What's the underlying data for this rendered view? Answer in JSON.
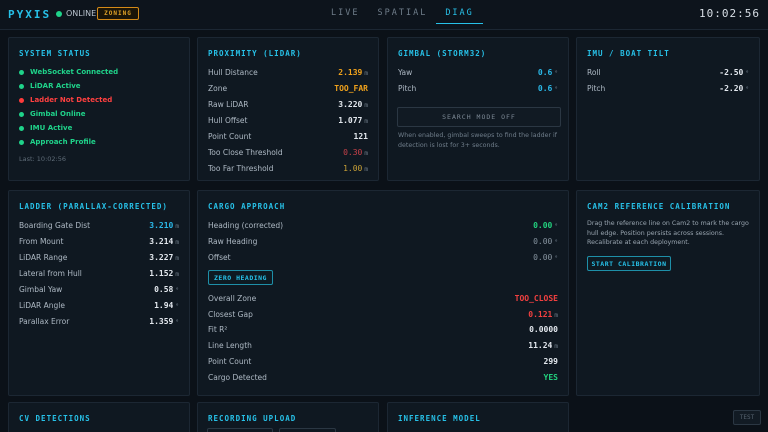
{
  "app": {
    "brand": "PYXIS",
    "online_label": "ONLINE",
    "zoning_badge": "ZONING",
    "clock": "10:02:56"
  },
  "tabs": [
    {
      "label": "LIVE"
    },
    {
      "label": "SPATIAL"
    },
    {
      "label": "DIAG"
    }
  ],
  "system_status": {
    "title": "SYSTEM STATUS",
    "items": [
      {
        "label": "WebSocket Connected",
        "state": "ok"
      },
      {
        "label": "LiDAR Active",
        "state": "ok"
      },
      {
        "label": "Ladder Not Detected",
        "state": "bad"
      },
      {
        "label": "Gimbal Online",
        "state": "ok"
      },
      {
        "label": "IMU Active",
        "state": "ok"
      },
      {
        "label": "Approach Profile",
        "state": "ok"
      }
    ],
    "last_update": "Last: 10:02:56"
  },
  "proximity": {
    "title": "PROXIMITY (LIDAR)",
    "rows": [
      {
        "label": "Hull Distance",
        "value": "2.139",
        "unit": "m"
      },
      {
        "label": "Zone",
        "value": "TOO_FAR",
        "unit": ""
      },
      {
        "label": "Raw LiDAR",
        "value": "3.220",
        "unit": "m"
      },
      {
        "label": "Hull Offset",
        "value": "1.077",
        "unit": "m"
      },
      {
        "label": "Point Count",
        "value": "121",
        "unit": ""
      },
      {
        "label": "Too Close Threshold",
        "value": "0.30",
        "unit": "m"
      },
      {
        "label": "Too Far Threshold",
        "value": "1.00",
        "unit": "m"
      }
    ]
  },
  "gimbal": {
    "title": "GIMBAL (STORM32)",
    "rows": [
      {
        "label": "Yaw",
        "value": "0.6",
        "unit": "°"
      },
      {
        "label": "Pitch",
        "value": "0.6",
        "unit": "°"
      }
    ],
    "search_button": "SEARCH MODE OFF",
    "note": "When enabled, gimbal sweeps to find the ladder if detection is lost for 3+ seconds."
  },
  "imu": {
    "title": "IMU / BOAT TILT",
    "rows": [
      {
        "label": "Roll",
        "value": "-2.50",
        "unit": "°"
      },
      {
        "label": "Pitch",
        "value": "-2.20",
        "unit": "°"
      }
    ]
  },
  "ladder": {
    "title": "LADDER (PARALLAX-CORRECTED)",
    "rows": [
      {
        "label": "Boarding Gate Dist",
        "value": "3.210",
        "unit": "m"
      },
      {
        "label": "From Mount",
        "value": "3.214",
        "unit": "m"
      },
      {
        "label": "LiDAR Range",
        "value": "3.227",
        "unit": "m"
      },
      {
        "label": "Lateral from Hull",
        "value": "1.152",
        "unit": "m"
      },
      {
        "label": "Gimbal Yaw",
        "value": "0.58",
        "unit": "°"
      },
      {
        "label": "LiDAR Angle",
        "value": "1.94",
        "unit": "°"
      },
      {
        "label": "Parallax Error",
        "value": "1.359",
        "unit": "°"
      }
    ]
  },
  "cargo": {
    "title": "CARGO APPROACH",
    "rows_top": [
      {
        "label": "Heading (corrected)",
        "value": "0.00",
        "unit": "°"
      },
      {
        "label": "Raw Heading",
        "value": "0.00",
        "unit": "°"
      },
      {
        "label": "Offset",
        "value": "0.00",
        "unit": "°"
      }
    ],
    "zero_button": "ZERO HEADING",
    "rows_bottom": [
      {
        "label": "Overall Zone",
        "value": "TOO_CLOSE",
        "unit": ""
      },
      {
        "label": "Closest Gap",
        "value": "0.121",
        "unit": "m"
      },
      {
        "label": "Fit R²",
        "value": "0.0000",
        "unit": ""
      },
      {
        "label": "Line Length",
        "value": "11.24",
        "unit": "m"
      },
      {
        "label": "Point Count",
        "value": "299",
        "unit": ""
      },
      {
        "label": "Cargo Detected",
        "value": "YES",
        "unit": ""
      }
    ]
  },
  "cam2": {
    "title": "CAM2 REFERENCE CALIBRATION",
    "note": "Drag the reference line on Cam2 to mark the cargo hull edge. Position persists across sessions. Recalibrate at each deployment.",
    "start_button": "START CALIBRATION"
  },
  "cv_detections": {
    "title": "CV DETECTIONS"
  },
  "recording": {
    "title": "RECORDING UPLOAD"
  },
  "inference": {
    "title": "INFERENCE MODEL"
  },
  "test_button": "TEST",
  "colors": {
    "accent": "#27c1e8",
    "ok": "#1fd38a",
    "bad": "#ff4040",
    "warn": "#f0a21c"
  }
}
